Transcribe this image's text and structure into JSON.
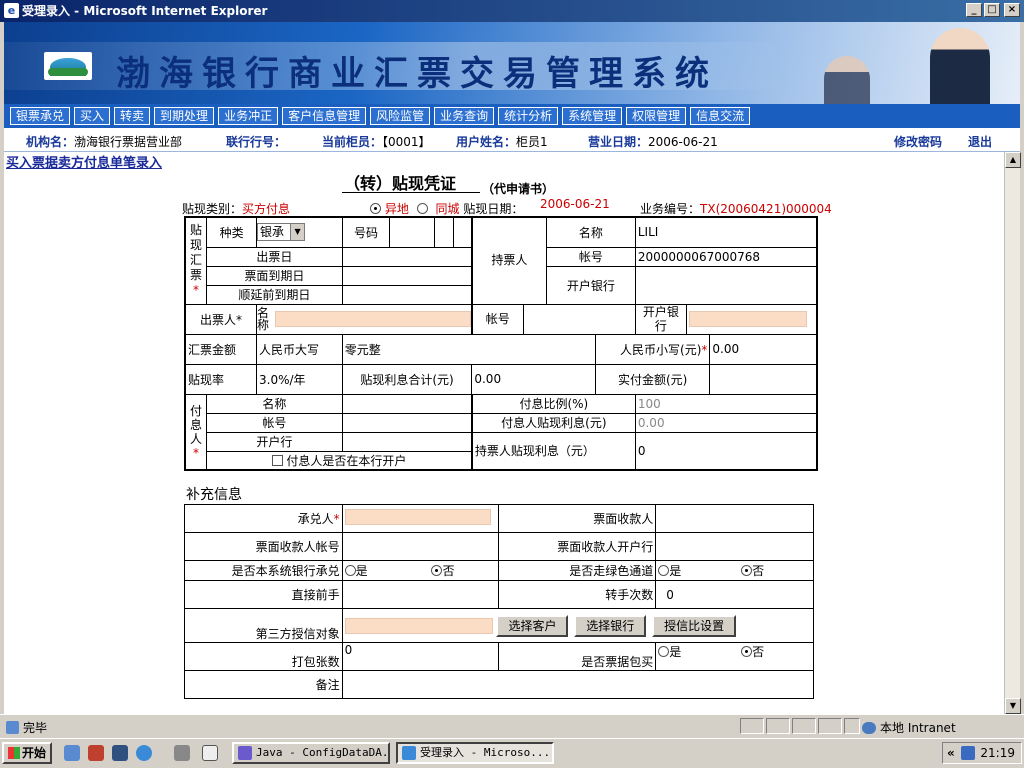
{
  "window": {
    "title": "受理录入 - Microsoft Internet Explorer"
  },
  "banner": {
    "title": "渤海银行商业汇票交易管理系统"
  },
  "menu": [
    "银票承兑",
    "买入",
    "转卖",
    "到期处理",
    "业务冲正",
    "客户信息管理",
    "风险监管",
    "业务查询",
    "统计分析",
    "系统管理",
    "权限管理",
    "信息交流"
  ],
  "info": {
    "org_label": "机构名：",
    "org_value": "渤海银行票据营业部",
    "bank_label": "联行行号：",
    "bank_value": "",
    "teller_label": "当前柜员：",
    "teller_value": "【0001】",
    "user_label": "用户姓名：",
    "user_value": "柜员1",
    "date_label": "营业日期：",
    "date_value": "2006-06-21",
    "change_pwd": "修改密码",
    "logout": "退出"
  },
  "page": {
    "heading": "买入票据卖方付息单笔录入",
    "doc_title": "（转）贴现凭证",
    "doc_sub": "（代申请书）",
    "category_label": "贴现类别：",
    "category_value": "买方付息",
    "opt_remote": "异地",
    "opt_local": "同城",
    "date_label": "贴现日期：",
    "date_value": "2006-06-21",
    "biz_no_label": "业务编号：",
    "biz_no_value": "TX(20060421)000004"
  },
  "form": {
    "bill_group": "贴现汇票",
    "star": "*",
    "kind_label": "种类",
    "kind_value": "银承",
    "number_label": "号码",
    "issue_date": "出票日",
    "due_date": "票面到期日",
    "ext_due_date": "顺延前到期日",
    "holder_group": "持票人",
    "holder_name_label": "名称",
    "holder_name_value": "LILI",
    "holder_acct_label": "帐号",
    "holder_acct_value": "2000000067000768",
    "holder_bank_label": "开户银行",
    "drawer_label": "出票人*",
    "drawer_name_label": "名称",
    "acct_label": "帐号",
    "open_bank_label": "开户银行",
    "amount_label": "汇票金额",
    "rmb_upper_label": "人民币大写",
    "rmb_upper_value": "零元整",
    "rmb_lower_label": "人民币小写(元)",
    "rmb_lower_value": "0.00",
    "rate_label": "贴现率",
    "rate_value": "3.0%/年",
    "interest_total_label": "贴现利息合计(元)",
    "interest_total_value": "0.00",
    "actual_label": "实付金额(元)",
    "actual_value": "",
    "payer_group": "付息人",
    "payer_name": "名称",
    "payer_acct": "帐号",
    "payer_bank": "开户行",
    "payer_ratio_label": "付息比例(%)",
    "payer_ratio_value": "100",
    "payer_interest_label": "付息人贴现利息(元)",
    "payer_interest_value": "0.00",
    "holder_interest_label": "持票人贴现利息（元）",
    "holder_interest_value": "0",
    "payer_in_bank": "付息人是否在本行开户"
  },
  "extra": {
    "title": "补充信息",
    "acceptor": "承兑人",
    "payee": "票面收款人",
    "payee_acct": "票面收款人帐号",
    "payee_bank": "票面收款人开户行",
    "own_accept": "是否本系统银行承兑",
    "green": "是否走绿色通道",
    "yes": "是",
    "no": "否",
    "prev_holder": "直接前手",
    "transfer_count": "转手次数",
    "transfer_count_value": "0",
    "third_party": "第三方授信对象",
    "btn_customer": "选择客户",
    "btn_bank": "选择银行",
    "btn_credit": "授信比设置",
    "pack_count": "打包张数",
    "pack_count_value": "0",
    "pack_buy": "是否票据包买",
    "remark": "备注"
  },
  "status": {
    "text": "完毕",
    "zone": "本地 Intranet"
  },
  "taskbar": {
    "start": "开始",
    "tasks": [
      "Java - ConfigDataDA...",
      "受理录入 - Microso..."
    ],
    "clock": "21:19"
  }
}
